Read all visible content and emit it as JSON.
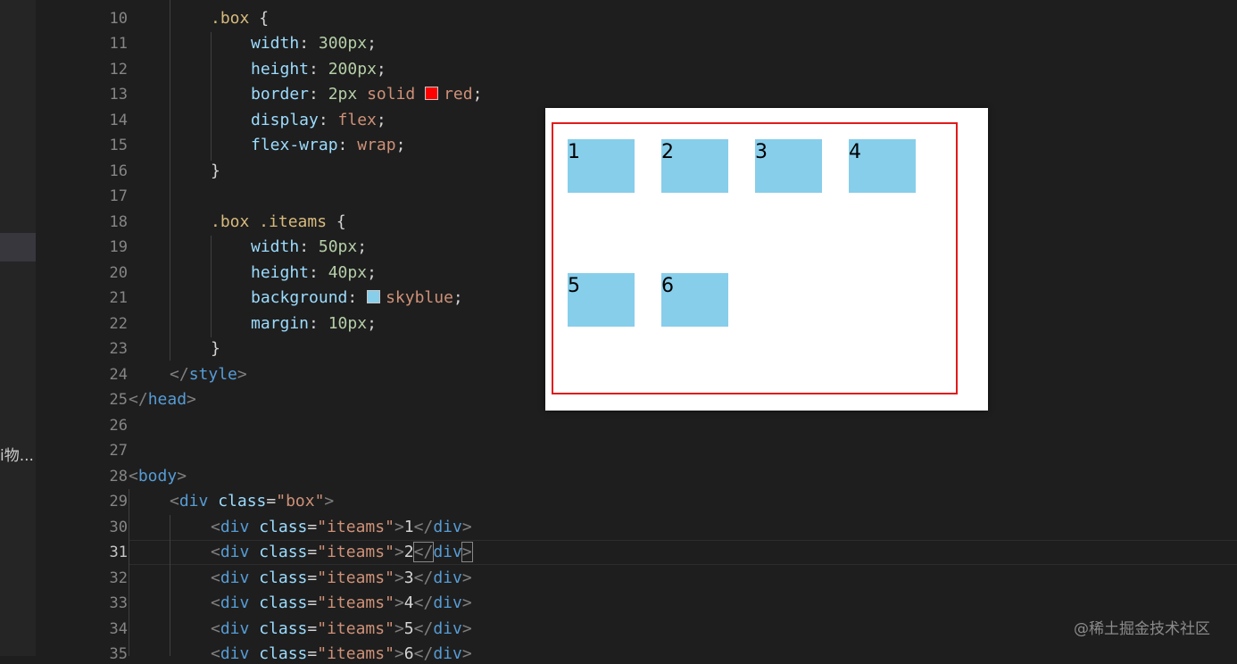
{
  "sidebar": {
    "truncated_label": "i物..."
  },
  "line_numbers": [
    "10",
    "11",
    "12",
    "13",
    "14",
    "15",
    "16",
    "17",
    "18",
    "19",
    "20",
    "21",
    "22",
    "23",
    "24",
    "25",
    "26",
    "27",
    "28",
    "29",
    "30",
    "31",
    "32",
    "33",
    "34",
    "35"
  ],
  "active_line": "31",
  "code": {
    "l10": {
      "selector": ".box",
      "brace": " {"
    },
    "l11": {
      "prop": "width",
      "colon": ": ",
      "value": "300px",
      "semi": ";"
    },
    "l12": {
      "prop": "height",
      "colon": ": ",
      "value": "200px",
      "semi": ";"
    },
    "l13": {
      "prop": "border",
      "colon": ": ",
      "num": "2px",
      "kw": " solid ",
      "color": "red",
      "semi": ";"
    },
    "l14": {
      "prop": "display",
      "colon": ": ",
      "value": "flex",
      "semi": ";"
    },
    "l15": {
      "prop": "flex-wrap",
      "colon": ": ",
      "value": "wrap",
      "semi": ";"
    },
    "l16": {
      "brace": "}"
    },
    "l18": {
      "selector": ".box .iteams",
      "brace": " {"
    },
    "l19": {
      "prop": "width",
      "colon": ": ",
      "value": "50px",
      "semi": ";"
    },
    "l20": {
      "prop": "height",
      "colon": ": ",
      "value": "40px",
      "semi": ";"
    },
    "l21": {
      "prop": "background",
      "colon": ": ",
      "color": "skyblue",
      "semi": ";"
    },
    "l22": {
      "prop": "margin",
      "colon": ": ",
      "value": "10px",
      "semi": ";"
    },
    "l23": {
      "brace": "}"
    },
    "l24": {
      "open": "</",
      "tag": "style",
      "close": ">"
    },
    "l25": {
      "open": "</",
      "tag": "head",
      "close": ">"
    },
    "l28": {
      "open": "<",
      "tag": "body",
      "close": ">"
    },
    "l29": {
      "open": "<",
      "tag": "div",
      "attr": " class",
      "eq": "=",
      "str": "\"box\"",
      "close": ">"
    },
    "div_lines": [
      {
        "open": "<",
        "tag": "div",
        "attr": " class",
        "eq": "=",
        "str": "\"iteams\"",
        "gt": ">",
        "text": "1",
        "endopen": "</",
        "endtag": "div",
        "endclose": ">"
      },
      {
        "open": "<",
        "tag": "div",
        "attr": " class",
        "eq": "=",
        "str": "\"iteams\"",
        "gt": ">",
        "text": "2",
        "endopen": "</",
        "endtag": "div",
        "endclose": ">"
      },
      {
        "open": "<",
        "tag": "div",
        "attr": " class",
        "eq": "=",
        "str": "\"iteams\"",
        "gt": ">",
        "text": "3",
        "endopen": "</",
        "endtag": "div",
        "endclose": ">"
      },
      {
        "open": "<",
        "tag": "div",
        "attr": " class",
        "eq": "=",
        "str": "\"iteams\"",
        "gt": ">",
        "text": "4",
        "endopen": "</",
        "endtag": "div",
        "endclose": ">"
      },
      {
        "open": "<",
        "tag": "div",
        "attr": " class",
        "eq": "=",
        "str": "\"iteams\"",
        "gt": ">",
        "text": "5",
        "endopen": "</",
        "endtag": "div",
        "endclose": ">"
      },
      {
        "open": "<",
        "tag": "div",
        "attr": " class",
        "eq": "=",
        "str": "\"iteams\"",
        "gt": ">",
        "text": "6",
        "endopen": "</",
        "endtag": "div",
        "endclose": ">"
      }
    ]
  },
  "colors": {
    "red_swatch": "#ff0000",
    "skyblue_swatch": "#87ceeb",
    "preview_border": "#e21a1a",
    "item_background": "#87ceeb"
  },
  "preview": {
    "items": [
      "1",
      "2",
      "3",
      "4",
      "5",
      "6"
    ]
  },
  "watermark": "@稀土掘金技术社区"
}
